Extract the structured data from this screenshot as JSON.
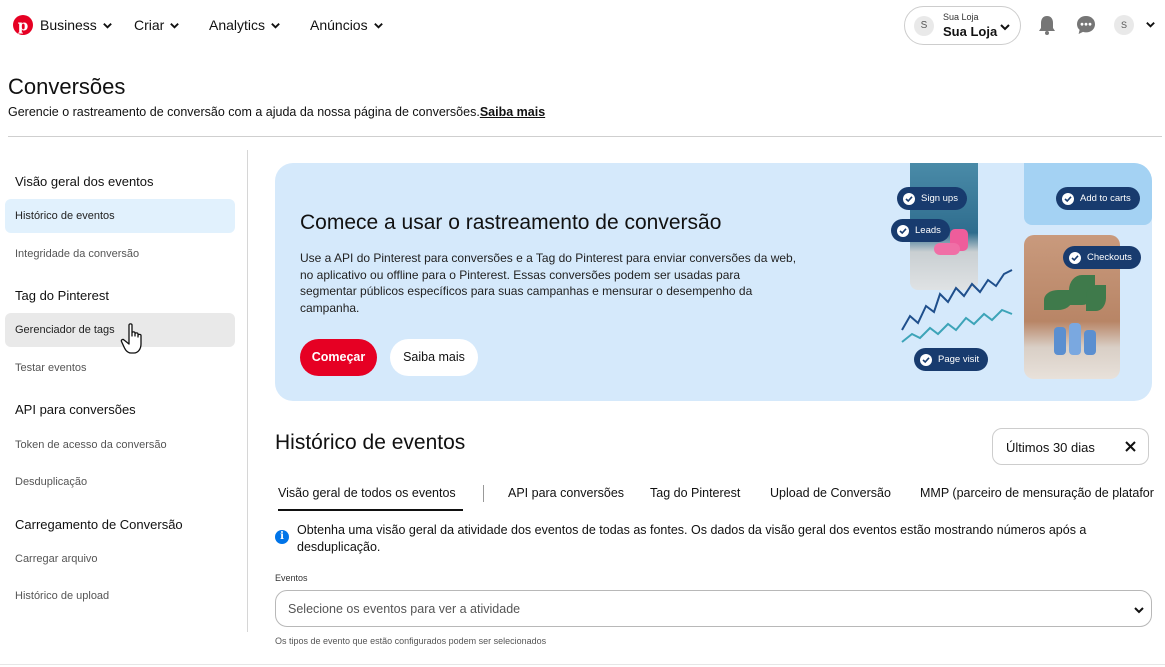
{
  "nav": {
    "brand": "Business",
    "items": [
      "Criar",
      "Analytics",
      "Anúncios"
    ],
    "account_small": "Sua Loja",
    "account_name": "Sua Loja",
    "avatar_letter": "S",
    "small_avatar_letter": "S"
  },
  "header": {
    "title": "Conversões",
    "subtitle": "Gerencie o rastreamento de conversão com a ajuda da nossa página de conversões.",
    "subtitle_link": "Saiba mais"
  },
  "sidebar": {
    "groups": [
      {
        "heading": "Visão geral dos eventos",
        "items": [
          "Histórico de eventos",
          "Integridade da conversão"
        ]
      },
      {
        "heading": "Tag do Pinterest",
        "items": [
          "Gerenciador de tags",
          "Testar eventos"
        ]
      },
      {
        "heading": "API para conversões",
        "items": [
          "Token de acesso da conversão",
          "Desduplicação"
        ]
      },
      {
        "heading": "Carregamento de Conversão",
        "items": [
          "Carregar arquivo",
          "Histórico de upload"
        ]
      }
    ],
    "active_item": "Histórico de eventos",
    "hover_item": "Gerenciador de tags"
  },
  "banner": {
    "title": "Comece a usar o rastreamento de conversão",
    "text": "Use a API do Pinterest para conversões e a Tag do Pinterest para enviar conversões da web, no aplicativo ou offline para o Pinterest. Essas conversões podem ser usadas para segmentar públicos específicos para suas campanhas e mensurar o desempenho da campanha.",
    "primary_button": "Começar",
    "secondary_button": "Saiba mais",
    "pills": {
      "signups": "Sign ups",
      "leads": "Leads",
      "add_to_carts": "Add to carts",
      "checkouts": "Checkouts",
      "page_visit": "Page visit"
    }
  },
  "section": {
    "title": "Histórico de eventos",
    "date_filter": "Últimos 30 dias",
    "tabs": [
      "Visão geral de todos os eventos",
      "API para conversões",
      "Tag do Pinterest",
      "Upload de Conversão",
      "MMP (parceiro de mensuração de platafor"
    ],
    "info_text": "Obtenha uma visão geral da atividade dos eventos de todas as fontes. Os dados da visão geral dos eventos estão mostrando números após a desduplicação.",
    "events_label": "Eventos",
    "events_placeholder": "Selecione os eventos para ver a atividade",
    "events_help": "Os tipos de evento que estão configurados podem ser selecionados"
  },
  "colors": {
    "brand_red": "#e60023",
    "banner_bg": "#d5e9fb",
    "active_item_bg": "#e1f1fd",
    "pill_bg": "#183b6e",
    "info_blue": "#0074e8"
  }
}
